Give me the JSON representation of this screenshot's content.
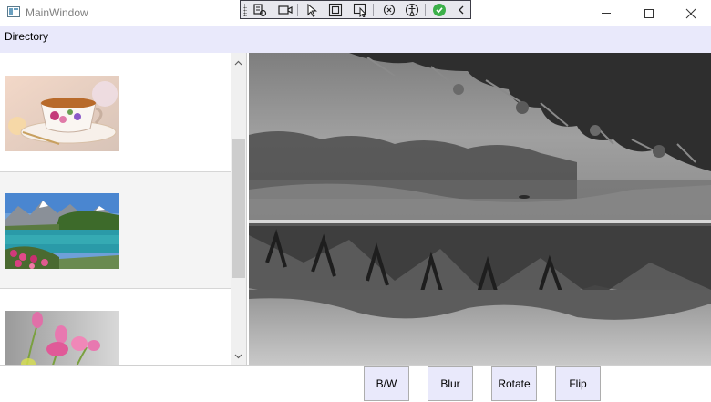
{
  "window": {
    "title": "MainWindow"
  },
  "window_controls": {
    "minimize": "minimize-icon",
    "maximize": "maximize-icon",
    "close": "close-icon"
  },
  "dev_toolbar": {
    "icons": [
      "grip-icon",
      "live-visual-tree-icon",
      "video-record-icon",
      "select-element-icon",
      "display-layout-adorners-icon",
      "track-focused-element-icon",
      "hot-reload-icon",
      "accessibility-icon",
      "checkmark-icon",
      "collapse-chevron-icon"
    ]
  },
  "menu": {
    "items": [
      "Directory"
    ]
  },
  "image_list": {
    "items": [
      {
        "icon": "teacup-thumbnail",
        "selected": false
      },
      {
        "icon": "mountain-lake-thumbnail",
        "selected": true
      },
      {
        "icon": "pink-tulips-thumbnail",
        "selected": false
      }
    ]
  },
  "preview": {
    "icon": "flipped-grayscale-landscape-image",
    "effects": [
      "grayscale",
      "flipped vertically"
    ]
  },
  "buttons": {
    "bw": "B/W",
    "blur": "Blur",
    "rotate": "Rotate",
    "flip": "Flip"
  },
  "colors": {
    "menu_bg": "#e9e9fb",
    "button_bg": "#e9e9fb",
    "selected_item_bg": "#f4f4f4",
    "scroll_thumb": "#cdcdcd"
  }
}
